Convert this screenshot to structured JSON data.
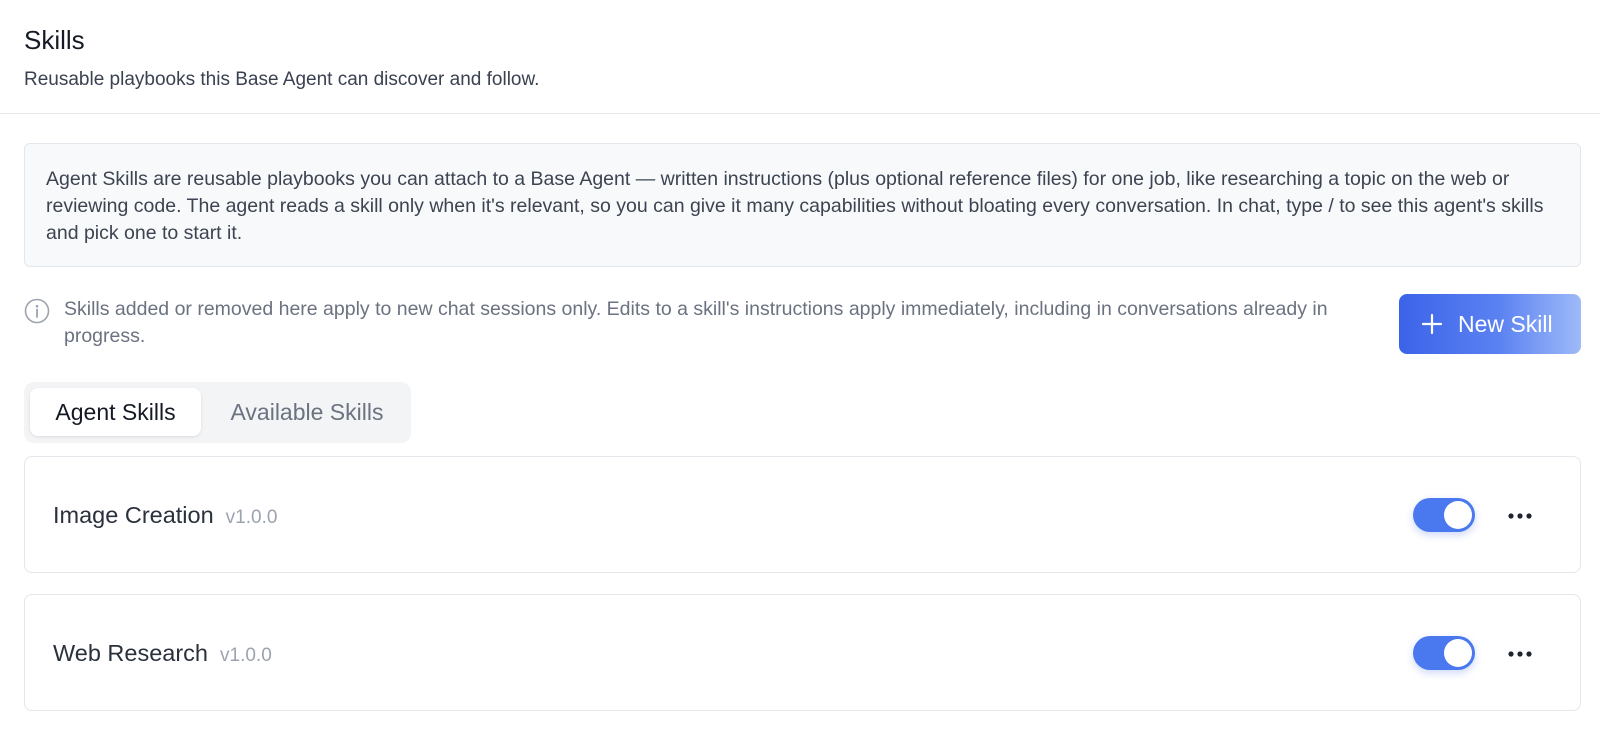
{
  "header": {
    "title": "Skills",
    "subtitle": "Reusable playbooks this Base Agent can discover and follow."
  },
  "info_box": {
    "text": "Agent Skills are reusable playbooks you can attach to a Base Agent — written instructions (plus optional reference files) for one job, like researching a topic on the web or reviewing code. The agent reads a skill only when it's relevant, so you can give it many capabilities without bloating every conversation. In chat, type / to see this agent's skills and pick one to start it."
  },
  "notice": {
    "icon": "info-icon",
    "text": "Skills added or removed here apply to new chat sessions only. Edits to a skill's instructions apply immediately, including in conversations already in progress."
  },
  "new_skill_button": {
    "icon": "plus-icon",
    "label": "New Skill"
  },
  "tabs": [
    {
      "label": "Agent Skills",
      "active": true
    },
    {
      "label": "Available Skills",
      "active": false
    }
  ],
  "skills": [
    {
      "name": "Image Creation",
      "version": "v1.0.0",
      "enabled": true
    },
    {
      "name": "Web Research",
      "version": "v1.0.0",
      "enabled": true
    }
  ],
  "colors": {
    "accent": "#4a78ee",
    "button_gradient_start": "#3b63e8",
    "button_gradient_end": "#9ebaf8",
    "info_box_bg": "#f7f9fb"
  }
}
